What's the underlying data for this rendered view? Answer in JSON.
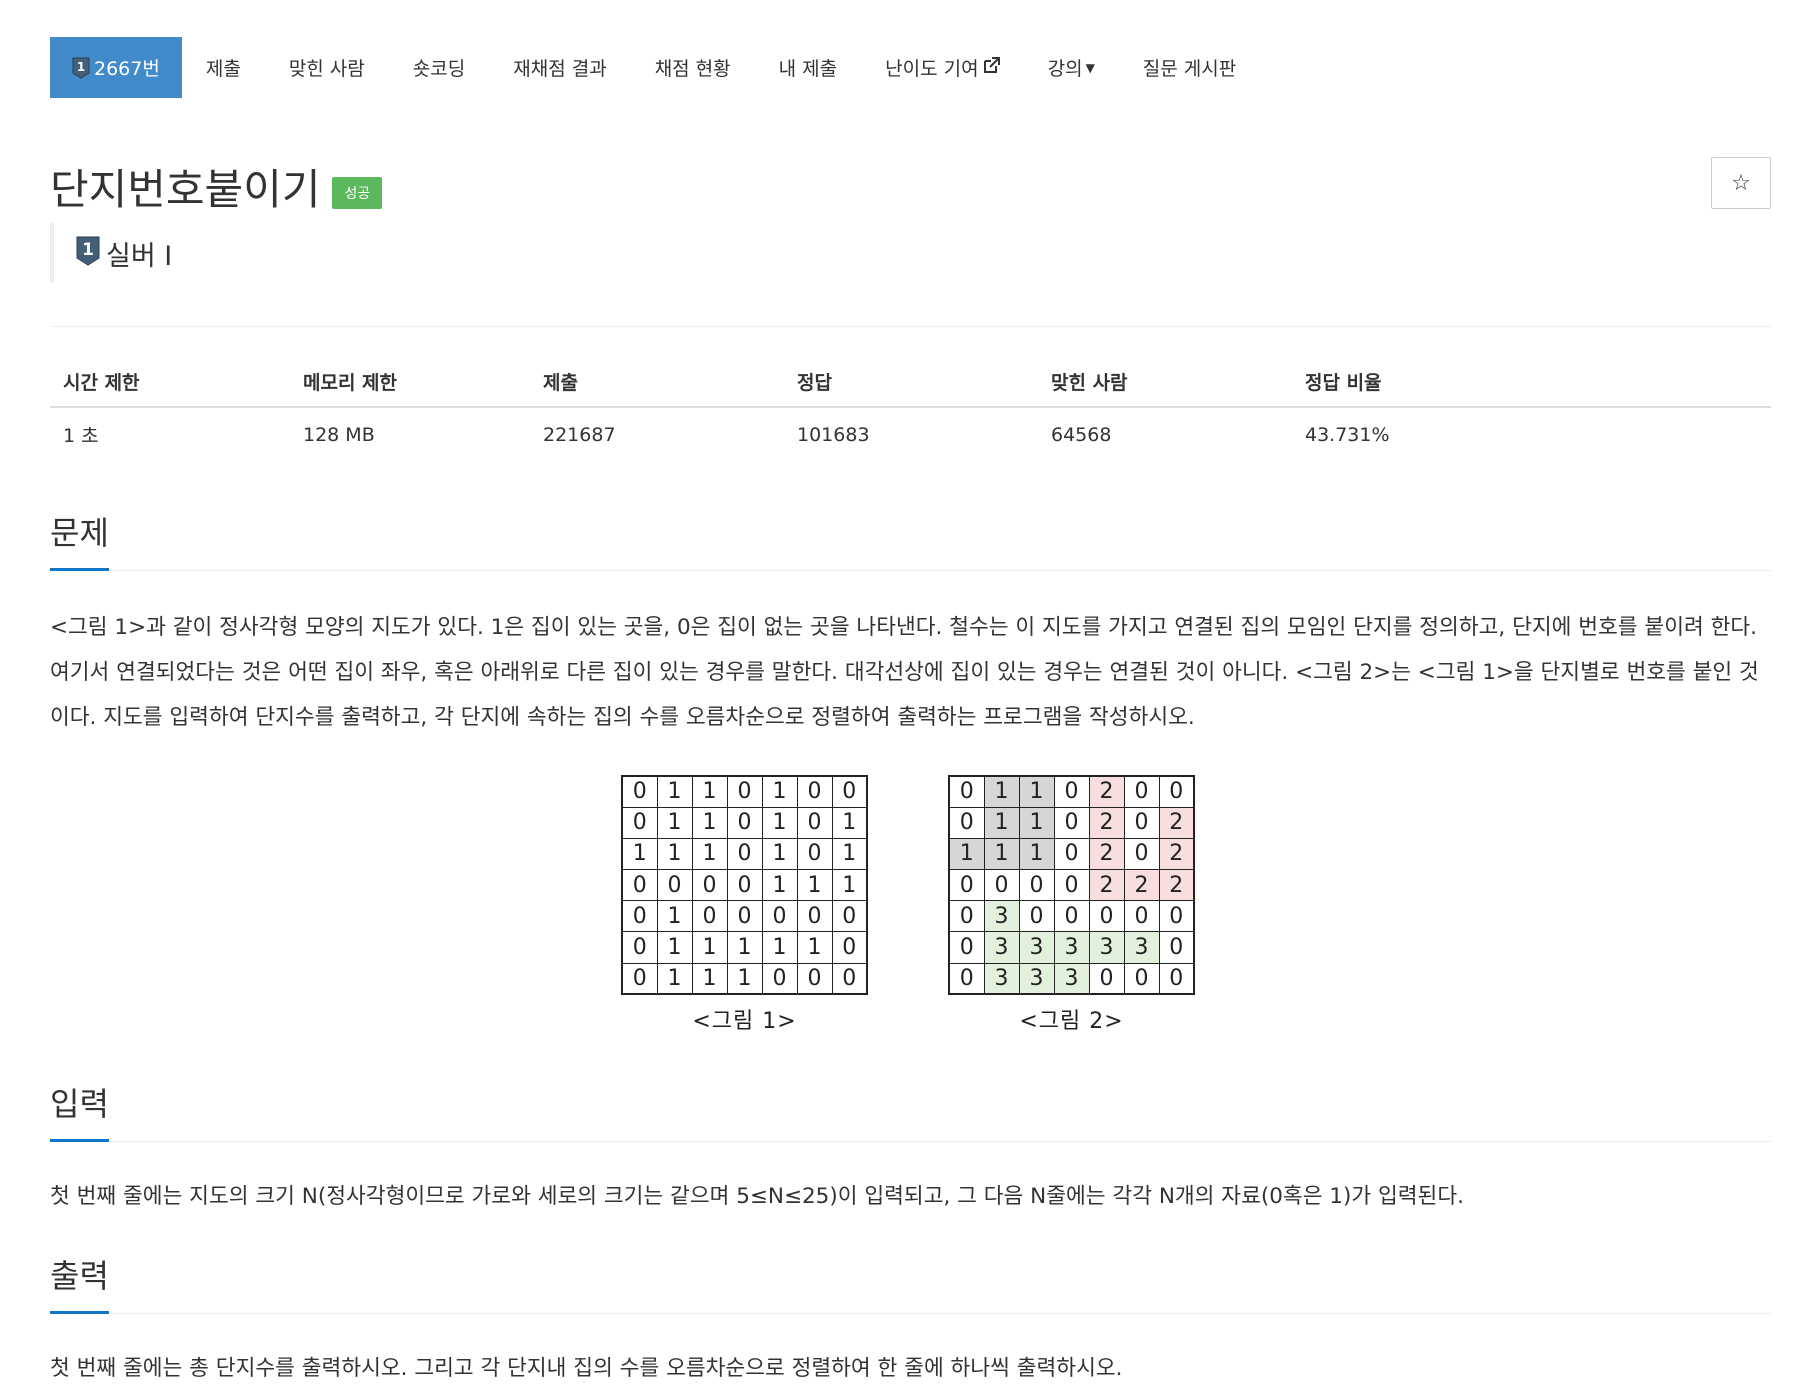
{
  "nav": {
    "problem_number": "2667번",
    "tier_badge_num": "1",
    "items": [
      {
        "label": "제출"
      },
      {
        "label": "맞힌 사람"
      },
      {
        "label": "숏코딩"
      },
      {
        "label": "재채점 결과"
      },
      {
        "label": "채점 현황"
      },
      {
        "label": "내 제출"
      },
      {
        "label": "난이도 기여"
      },
      {
        "label": "강의"
      },
      {
        "label": "질문 게시판"
      }
    ]
  },
  "problem": {
    "title": "단지번호붙이기",
    "status_label": "성공",
    "tier_label": "실버 I",
    "star_icon": "☆"
  },
  "info_table": {
    "headers": [
      "시간 제한",
      "메모리 제한",
      "제출",
      "정답",
      "맞힌 사람",
      "정답 비율"
    ],
    "values": [
      "1 초",
      "128 MB",
      "221687",
      "101683",
      "64568",
      "43.731%"
    ]
  },
  "sections": {
    "problem_heading": "문제",
    "problem_text": "<그림 1>과 같이 정사각형 모양의 지도가 있다. 1은 집이 있는 곳을, 0은 집이 없는 곳을 나타낸다. 철수는 이 지도를 가지고 연결된 집의 모임인 단지를 정의하고, 단지에 번호를 붙이려 한다. 여기서 연결되었다는 것은 어떤 집이 좌우, 혹은 아래위로 다른 집이 있는 경우를 말한다. 대각선상에 집이 있는 경우는 연결된 것이 아니다. <그림 2>는 <그림 1>을 단지별로 번호를 붙인 것이다. 지도를 입력하여 단지수를 출력하고, 각 단지에 속하는 집의 수를 오름차순으로 정렬하여 출력하는 프로그램을 작성하시오.",
    "input_heading": "입력",
    "input_text": "첫 번째 줄에는 지도의 크기 N(정사각형이므로 가로와 세로의 크기는 같으며 5≤N≤25)이 입력되고, 그 다음 N줄에는 각각 N개의 자료(0혹은 1)가 입력된다.",
    "output_heading": "출력",
    "output_text": "첫 번째 줄에는 총 단지수를 출력하시오. 그리고 각 단지내 집의 수를 오름차순으로 정렬하여 한 줄에 하나씩 출력하시오."
  },
  "figures": {
    "figure1": {
      "caption": "<그림 1>",
      "grid": [
        [
          0,
          1,
          1,
          0,
          1,
          0,
          0
        ],
        [
          0,
          1,
          1,
          0,
          1,
          0,
          1
        ],
        [
          1,
          1,
          1,
          0,
          1,
          0,
          1
        ],
        [
          0,
          0,
          0,
          0,
          1,
          1,
          1
        ],
        [
          0,
          1,
          0,
          0,
          0,
          0,
          0
        ],
        [
          0,
          1,
          1,
          1,
          1,
          1,
          0
        ],
        [
          0,
          1,
          1,
          1,
          0,
          0,
          0
        ]
      ]
    },
    "figure2": {
      "caption": "<그림 2>",
      "grid": [
        [
          0,
          1,
          1,
          0,
          2,
          0,
          0
        ],
        [
          0,
          1,
          1,
          0,
          2,
          0,
          2
        ],
        [
          1,
          1,
          1,
          0,
          2,
          0,
          2
        ],
        [
          0,
          0,
          0,
          0,
          2,
          2,
          2
        ],
        [
          0,
          3,
          0,
          0,
          0,
          0,
          0
        ],
        [
          0,
          3,
          3,
          3,
          3,
          3,
          0
        ],
        [
          0,
          3,
          3,
          3,
          0,
          0,
          0
        ]
      ],
      "colors": {
        "1": "#d6d6d6",
        "2": "#f8dede",
        "3": "#e2f1de"
      }
    }
  },
  "colors": {
    "nav_active": "#428bca",
    "success_label": "#5cb85c",
    "section_underline": "#0e76c5"
  }
}
